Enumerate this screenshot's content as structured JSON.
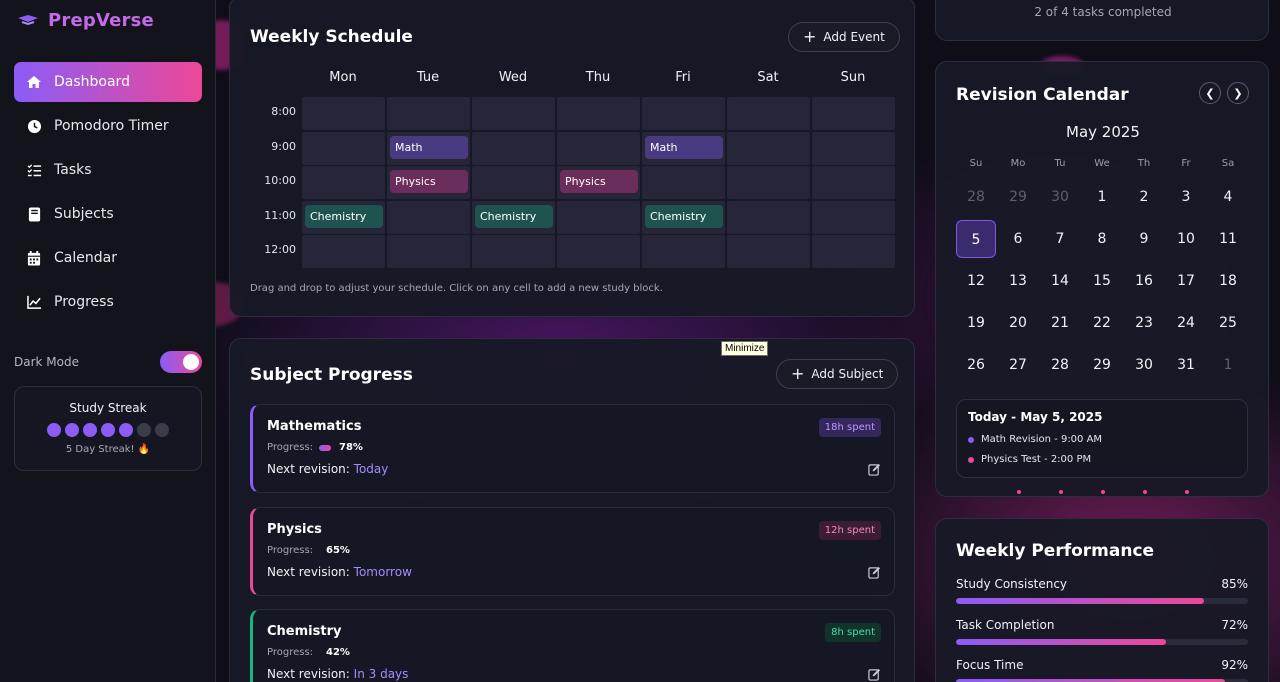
{
  "app": {
    "name": "PrepVerse"
  },
  "sidebar": {
    "items": [
      {
        "label": "Dashboard",
        "icon": "home-icon",
        "active": true
      },
      {
        "label": "Pomodoro Timer",
        "icon": "clock-icon",
        "active": false
      },
      {
        "label": "Tasks",
        "icon": "checklist-icon",
        "active": false
      },
      {
        "label": "Subjects",
        "icon": "book-icon",
        "active": false
      },
      {
        "label": "Calendar",
        "icon": "calendar-icon",
        "active": false
      },
      {
        "label": "Progress",
        "icon": "chart-line-icon",
        "active": false
      }
    ],
    "dark_mode_label": "Dark Mode",
    "dark_mode_on": true,
    "streak": {
      "title": "Study Streak",
      "days_on": 5,
      "days_total": 7,
      "text": "5 Day Streak! 🔥"
    }
  },
  "schedule": {
    "title": "Weekly Schedule",
    "add_label": "Add Event",
    "days": [
      "Mon",
      "Tue",
      "Wed",
      "Thu",
      "Fri",
      "Sat",
      "Sun"
    ],
    "times": [
      "8:00",
      "9:00",
      "10:00",
      "11:00",
      "12:00"
    ],
    "events": [
      {
        "label": "Math",
        "day": 1,
        "slot": 1,
        "type": "math"
      },
      {
        "label": "Math",
        "day": 4,
        "slot": 1,
        "type": "math"
      },
      {
        "label": "Physics",
        "day": 1,
        "slot": 2,
        "type": "phys"
      },
      {
        "label": "Physics",
        "day": 3,
        "slot": 2,
        "type": "phys"
      },
      {
        "label": "Chemistry",
        "day": 0,
        "slot": 3,
        "type": "chem"
      },
      {
        "label": "Chemistry",
        "day": 2,
        "slot": 3,
        "type": "chem"
      },
      {
        "label": "Chemistry",
        "day": 4,
        "slot": 3,
        "type": "chem"
      }
    ],
    "hint": "Drag and drop to adjust your schedule. Click on any cell to add a new study block."
  },
  "subjects": {
    "title": "Subject Progress",
    "add_label": "Add Subject",
    "progress_label": "Progress:",
    "next_label": "Next revision:",
    "items": [
      {
        "name": "Mathematics",
        "progress": "78%",
        "next": "Today",
        "spent": "18h spent",
        "color": "#8b5cf6",
        "badge_bg": "#33275c",
        "badge_fg": "#b79cff"
      },
      {
        "name": "Physics",
        "progress": "65%",
        "next": "Tomorrow",
        "spent": "12h spent",
        "color": "#ec4899",
        "badge_bg": "#3d1d35",
        "badge_fg": "#f08bbf"
      },
      {
        "name": "Chemistry",
        "progress": "42%",
        "next": "In 3 days",
        "spent": "8h spent",
        "color": "#10b981",
        "badge_bg": "#12332b",
        "badge_fg": "#4ddba7"
      }
    ]
  },
  "tooltip": {
    "text": "Minimize"
  },
  "tasks": {
    "text": "2 of 4 tasks completed"
  },
  "calendar": {
    "title": "Revision Calendar",
    "month": "May 2025",
    "dow": [
      "Su",
      "Mo",
      "Tu",
      "We",
      "Th",
      "Fr",
      "Sa"
    ],
    "days": [
      {
        "d": "28",
        "m": true
      },
      {
        "d": "29",
        "m": true
      },
      {
        "d": "30",
        "m": true
      },
      {
        "d": "1"
      },
      {
        "d": "2"
      },
      {
        "d": "3"
      },
      {
        "d": "4"
      },
      {
        "d": "5",
        "t": true
      },
      {
        "d": "6"
      },
      {
        "d": "7"
      },
      {
        "d": "8"
      },
      {
        "d": "9"
      },
      {
        "d": "10"
      },
      {
        "d": "11"
      },
      {
        "d": "12"
      },
      {
        "d": "13"
      },
      {
        "d": "14"
      },
      {
        "d": "15"
      },
      {
        "d": "16"
      },
      {
        "d": "17"
      },
      {
        "d": "18"
      },
      {
        "d": "19"
      },
      {
        "d": "20"
      },
      {
        "d": "21"
      },
      {
        "d": "22"
      },
      {
        "d": "23"
      },
      {
        "d": "24"
      },
      {
        "d": "25"
      },
      {
        "d": "26"
      },
      {
        "d": "27"
      },
      {
        "d": "28"
      },
      {
        "d": "29"
      },
      {
        "d": "30"
      },
      {
        "d": "31"
      },
      {
        "d": "1",
        "m": true
      }
    ],
    "today_title": "Today - May 5, 2025",
    "today_events": [
      {
        "text": "Math Revision - 9:00 AM",
        "color": "#8b5cf6"
      },
      {
        "text": "Physics Test - 2:00 PM",
        "color": "#ec4899"
      }
    ]
  },
  "performance": {
    "title": "Weekly Performance",
    "items": [
      {
        "label": "Study Consistency",
        "value": "85%",
        "fraction": 0.85
      },
      {
        "label": "Task Completion",
        "value": "72%",
        "fraction": 0.72
      },
      {
        "label": "Focus Time",
        "value": "92%",
        "fraction": 0.92
      }
    ]
  }
}
